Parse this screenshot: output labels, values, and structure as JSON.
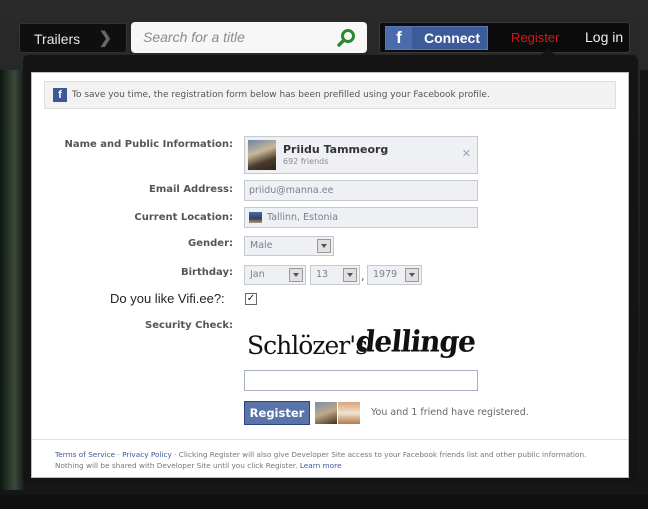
{
  "topbar": {
    "trailers_label": "Trailers",
    "search_placeholder": "Search for a title",
    "connect_label": "Connect",
    "register_label": "Register",
    "login_label": "Log in"
  },
  "notice": {
    "text": "To save you time, the registration form below has been prefilled using your Facebook profile."
  },
  "form": {
    "name_label": "Name and Public Information:",
    "profile_name": "Priidu Tammeorg",
    "profile_friends": "692 friends",
    "email_label": "Email Address:",
    "email_value": "priidu@manna.ee",
    "location_label": "Current Location:",
    "location_value": "Tallinn, Estonia",
    "gender_label": "Gender:",
    "gender_value": "Male",
    "birthday_label": "Birthday:",
    "birthday_month": "Jan",
    "birthday_day": "13",
    "birthday_year": "1979",
    "vifi_question": "Do you like Vifi.ee?:",
    "vifi_checked": true,
    "security_label": "Security Check:",
    "captcha_word1": "Schlözer's",
    "captcha_word2": "dellinge",
    "register_button": "Register",
    "registered_text": "You and 1 friend have registered."
  },
  "footer": {
    "terms": "Terms of Service",
    "sep": " · ",
    "privacy": "Privacy Policy",
    "text": " · Clicking Register will also give Developer Site access to your Facebook friends list and other public information. Nothing will be shared with Developer Site until you click Register. ",
    "learn_more": "Learn more"
  },
  "colors": {
    "facebook_blue": "#3b5998",
    "register_red": "#d7161c",
    "search_icon_green": "#2c8a2c"
  }
}
